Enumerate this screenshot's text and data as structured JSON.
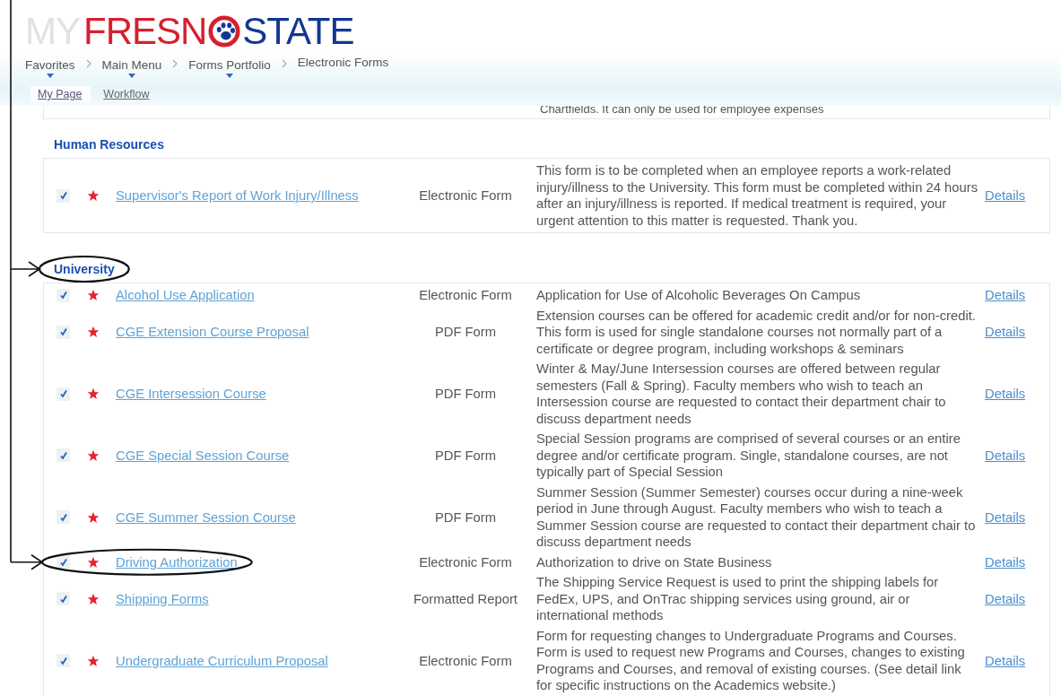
{
  "logo": {
    "prefix": "MY",
    "red_part": "FRESN",
    "blue_part": "STATE"
  },
  "breadcrumb": [
    {
      "label": "Favorites",
      "has_menu": true
    },
    {
      "label": "Main Menu",
      "has_menu": true
    },
    {
      "label": "Forms Portfolio",
      "has_menu": true
    },
    {
      "label": "Electronic Forms",
      "has_menu": false
    }
  ],
  "tabs": [
    {
      "label": "My Page",
      "selected": true
    },
    {
      "label": "Workflow",
      "selected": false
    }
  ],
  "clipped_line": "Chartfields. It can only be used for employee expenses",
  "sections": [
    {
      "title": "Human Resources",
      "circled": false,
      "rows": [
        {
          "checked": true,
          "favorite": true,
          "name": "Supervisor's Report of Work Injury/Illness",
          "type": "Electronic Form",
          "description": "This form is to be completed when an employee reports a work-related injury/illness to the University. This form must be completed within 24 hours after an injury/illness is reported. If medical treatment is required, your urgent attention to this matter is requested. Thank you.",
          "details": "Details",
          "circled": false
        }
      ]
    },
    {
      "title": "University",
      "circled": true,
      "rows": [
        {
          "checked": true,
          "favorite": true,
          "name": "Alcohol Use Application",
          "type": "Electronic Form",
          "description": "Application for Use of Alcoholic Beverages On Campus",
          "details": "Details",
          "circled": false
        },
        {
          "checked": true,
          "favorite": true,
          "name": "CGE Extension Course Proposal",
          "type": "PDF Form",
          "description": "Extension courses can be offered for academic credit and/or for non-credit. This form is used for single standalone courses not normally part of a certificate or degree program, including workshops & seminars",
          "details": "Details",
          "circled": false
        },
        {
          "checked": true,
          "favorite": true,
          "name": "CGE Intersession Course",
          "type": "PDF Form",
          "description": "Winter & May/June Intersession courses are offered between regular semesters (Fall & Spring). Faculty members who wish to teach an Intersession course are requested to contact their department chair to discuss department needs",
          "details": "Details",
          "circled": false
        },
        {
          "checked": true,
          "favorite": true,
          "name": "CGE Special Session Course",
          "type": "PDF Form",
          "description": "Special Session programs are comprised of several courses or an entire degree and/or certificate program. Single, standalone courses, are not typically part of Special Session",
          "details": "Details",
          "circled": false
        },
        {
          "checked": true,
          "favorite": true,
          "name": "CGE Summer Session Course",
          "type": "PDF Form",
          "description": "Summer Session (Summer Semester) courses occur during a nine-week period in June through August. Faculty members who wish to teach a Summer Session course are requested to contact their department chair to discuss department needs",
          "details": "Details",
          "circled": false
        },
        {
          "checked": true,
          "favorite": true,
          "name": "Driving Authorization",
          "type": "Electronic Form",
          "description": "Authorization to drive on State Business",
          "details": "Details",
          "circled": true
        },
        {
          "checked": true,
          "favorite": true,
          "name": "Shipping Forms",
          "type": "Formatted Report",
          "description": "The Shipping Service Request is used to print the shipping labels for FedEx, UPS, and OnTrac shipping services using ground, air or international methods",
          "details": "Details",
          "circled": false
        },
        {
          "checked": true,
          "favorite": true,
          "name": "Undergraduate Curriculum Proposal",
          "type": "Electronic Form",
          "description": "Form for requesting changes to Undergraduate Programs and Courses. Form is used to request new Programs and Courses, changes to existing Programs and Courses, and removal of existing courses. (See detail link for specific instructions on the Academics website.)",
          "details": "Details",
          "circled": false
        }
      ]
    }
  ]
}
